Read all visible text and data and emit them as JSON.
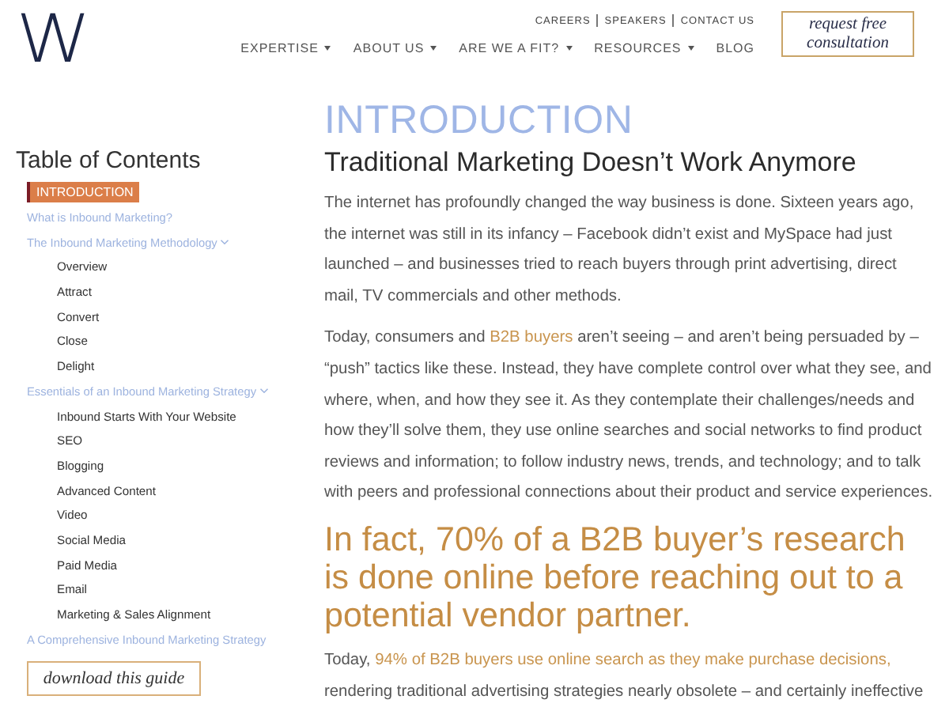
{
  "header": {
    "logo": "W",
    "utility_links": [
      "CAREERS",
      "SPEAKERS",
      "CONTACT US"
    ],
    "nav": [
      {
        "label": "EXPERTISE",
        "dropdown": true
      },
      {
        "label": "ABOUT US",
        "dropdown": true
      },
      {
        "label": "ARE WE A FIT?",
        "dropdown": true
      },
      {
        "label": "RESOURCES",
        "dropdown": true
      },
      {
        "label": "BLOG",
        "dropdown": false
      }
    ],
    "cta_button": "request free consultation"
  },
  "sidebar": {
    "title": "Table of Contents",
    "items": [
      {
        "label": "INTRODUCTION",
        "selected": true
      },
      {
        "label": "What is Inbound Marketing?",
        "selected": false
      },
      {
        "label": "The Inbound Marketing Methodology",
        "selected": false,
        "expanded": true,
        "children": [
          {
            "label": "Overview"
          },
          {
            "label": "Attract"
          },
          {
            "label": "Convert"
          },
          {
            "label": "Close"
          },
          {
            "label": "Delight"
          }
        ]
      },
      {
        "label": "Essentials of an Inbound Marketing Strategy",
        "selected": false,
        "expanded": true,
        "children": [
          {
            "label": "Inbound Starts With Your Website"
          },
          {
            "label": "SEO"
          },
          {
            "label": "Blogging"
          },
          {
            "label": "Advanced Content"
          },
          {
            "label": "Video"
          },
          {
            "label": "Social Media"
          },
          {
            "label": "Paid Media"
          },
          {
            "label": "Email"
          },
          {
            "label": "Marketing & Sales Alignment"
          }
        ]
      },
      {
        "label": "A Comprehensive Inbound Marketing Strategy",
        "selected": false
      }
    ],
    "download_button": "download this guide"
  },
  "article": {
    "section_title": "INTRODUCTION",
    "heading": "Traditional Marketing Doesn’t Work Anymore",
    "blocks": [
      {
        "kind": "paragraph",
        "segments": [
          {
            "kind": "text",
            "text": "The internet has profoundly changed the way business is done. Sixteen years ago, the internet was still in its infancy – Facebook didn’t exist and MySpace had just launched – and businesses tried to reach buyers through print advertising, direct mail, TV commercials and other methods."
          }
        ]
      },
      {
        "kind": "paragraph",
        "segments": [
          {
            "kind": "text",
            "text": "Today, consumers and "
          },
          {
            "kind": "link",
            "text": "B2B buyers"
          },
          {
            "kind": "text",
            "text": " aren’t seeing – and aren’t being persuaded by – “push” tactics like these. Instead, they have complete control over what they see, and where, when, and how they see it. As they contemplate their challenges/needs and how they’ll solve them, they use online searches and social networks to find product reviews and information; to follow industry news, trends, and technology; and to talk with peers and professional connections about their product and service experiences."
          }
        ]
      },
      {
        "kind": "quote",
        "text": "In fact, 70% of a B2B buyer’s research is done online before reaching out to a potential vendor partner."
      },
      {
        "kind": "paragraph",
        "segments": [
          {
            "kind": "text",
            "text": "Today, "
          },
          {
            "kind": "link",
            "text": "94% of B2B buyers use online search as they make purchase decisions,"
          },
          {
            "kind": "text",
            "text": " rendering traditional advertising strategies nearly obsolete – and certainly ineffective"
          }
        ]
      }
    ]
  }
}
